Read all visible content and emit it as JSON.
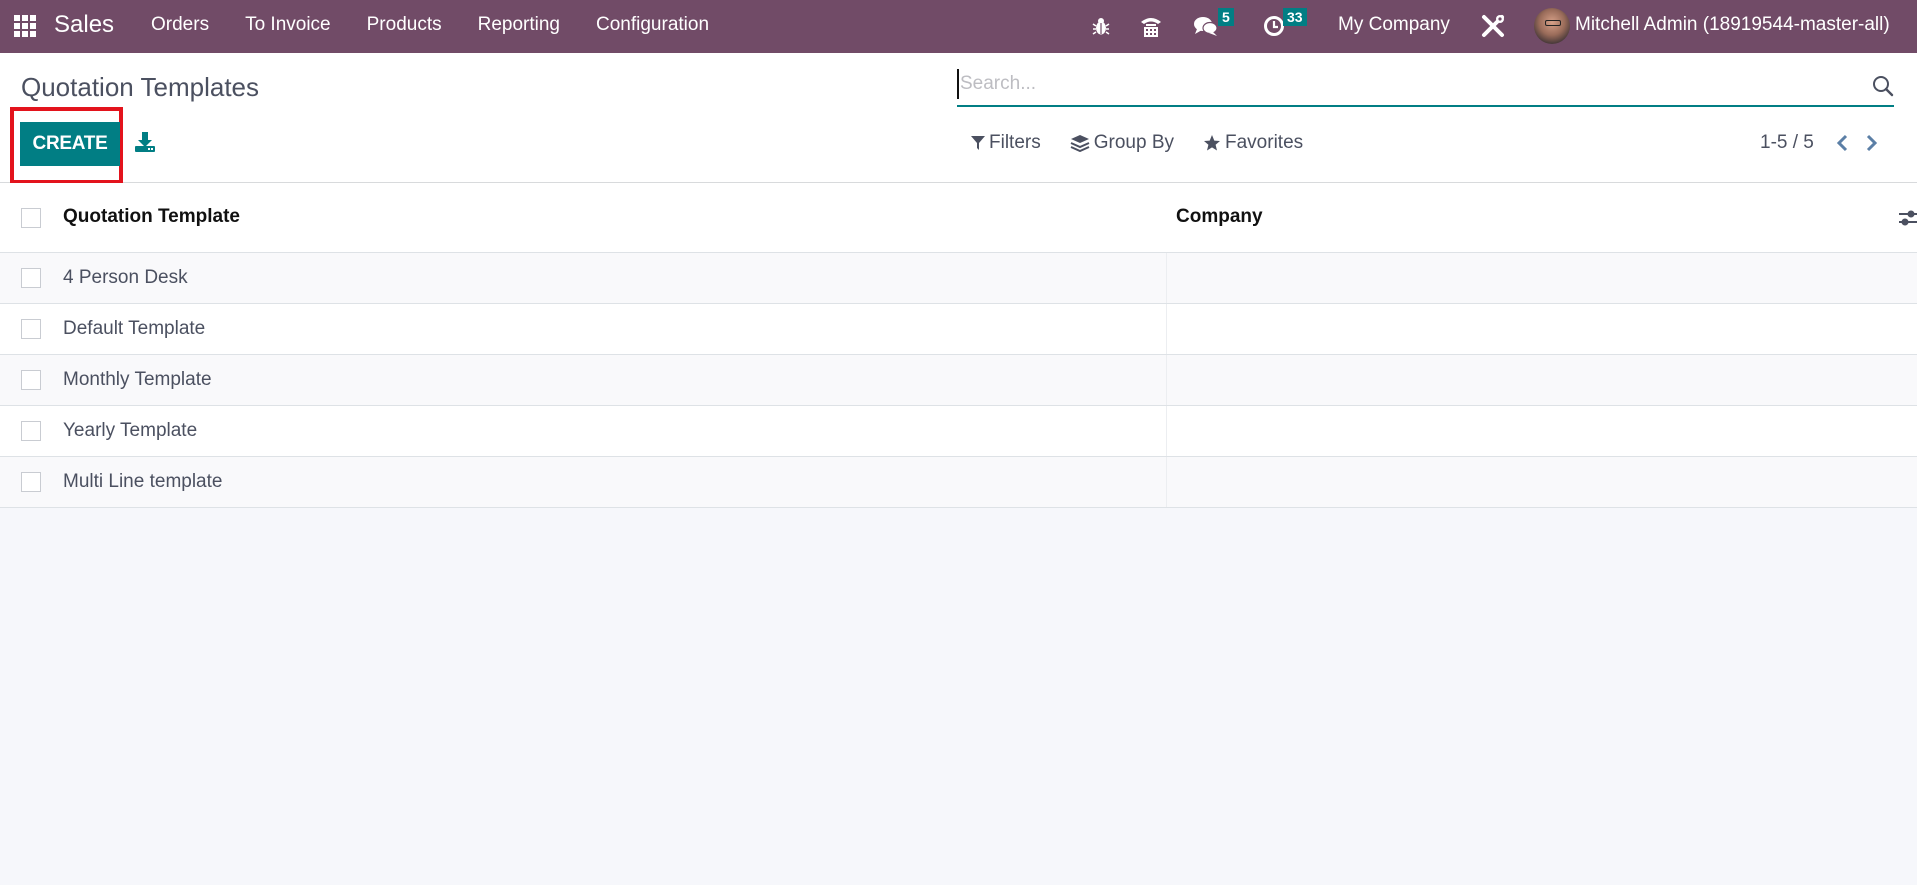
{
  "navbar": {
    "app_name": "Sales",
    "menu": [
      {
        "label": "Orders"
      },
      {
        "label": "To Invoice"
      },
      {
        "label": "Products"
      },
      {
        "label": "Reporting"
      },
      {
        "label": "Configuration"
      }
    ],
    "icons": {
      "apps": "apps-grid-icon",
      "debug": "bug-icon",
      "voip": "phone-icon",
      "messages": "chat-icon",
      "activities": "clock-icon",
      "settings": "tools-icon"
    },
    "messages_count": "5",
    "activities_count": "33",
    "company": "My Company",
    "user": "Mitchell Admin (18919544-master-all)"
  },
  "control_panel": {
    "title": "Quotation Templates",
    "create_label": "CREATE",
    "search_placeholder": "Search...",
    "search_value": "",
    "filters_label": "Filters",
    "group_by_label": "Group By",
    "favorites_label": "Favorites",
    "pager": "1-5 / 5"
  },
  "table": {
    "columns": [
      {
        "label": "Quotation Template"
      },
      {
        "label": "Company"
      }
    ],
    "rows": [
      {
        "name": "4 Person Desk",
        "company": ""
      },
      {
        "name": "Default Template",
        "company": ""
      },
      {
        "name": "Monthly Template",
        "company": ""
      },
      {
        "name": "Yearly Template",
        "company": ""
      },
      {
        "name": "Multi Line template",
        "company": ""
      }
    ]
  },
  "colors": {
    "navbar": "#714b67",
    "primary": "#017e84",
    "highlight": "#e3131c",
    "pager_arrow": "#5b7fa6"
  }
}
